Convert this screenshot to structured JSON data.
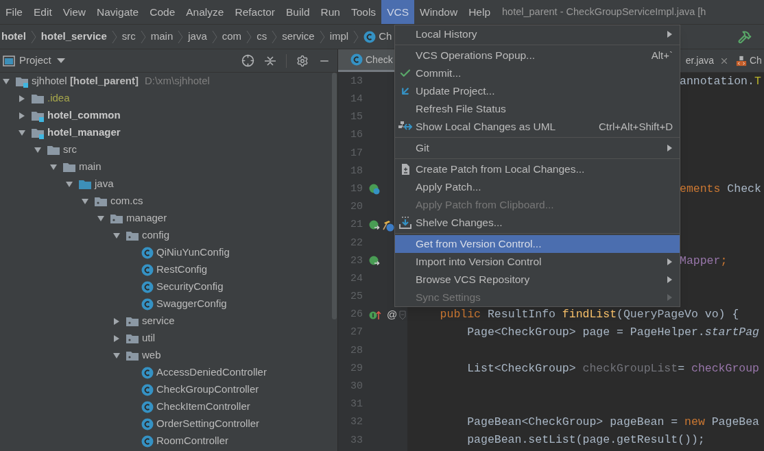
{
  "menu_bar": [
    {
      "label": "File",
      "selected": false
    },
    {
      "label": "Edit",
      "selected": false
    },
    {
      "label": "View",
      "selected": false
    },
    {
      "label": "Navigate",
      "selected": false
    },
    {
      "label": "Code",
      "selected": false
    },
    {
      "label": "Analyze",
      "selected": false
    },
    {
      "label": "Refactor",
      "selected": false
    },
    {
      "label": "Build",
      "selected": false
    },
    {
      "label": "Run",
      "selected": false
    },
    {
      "label": "Tools",
      "selected": false
    },
    {
      "label": "VCS",
      "selected": true
    },
    {
      "label": "Window",
      "selected": false
    },
    {
      "label": "Help",
      "selected": false
    }
  ],
  "window": {
    "title": "hotel_parent - CheckGroupServiceImpl.java [h"
  },
  "breadcrumb": [
    {
      "label": "hotel",
      "kind": "module"
    },
    {
      "label": "hotel_service",
      "kind": "module"
    },
    {
      "label": "src",
      "kind": "folder"
    },
    {
      "label": "main",
      "kind": "folder"
    },
    {
      "label": "java",
      "kind": "folder"
    },
    {
      "label": "com",
      "kind": "folder"
    },
    {
      "label": "cs",
      "kind": "folder"
    },
    {
      "label": "service",
      "kind": "folder"
    },
    {
      "label": "impl",
      "kind": "folder"
    },
    {
      "label": "Ch",
      "kind": "class"
    }
  ],
  "project_panel": {
    "title": "Project",
    "tree": [
      {
        "label": "sjhhotel **[hotel_parent]**",
        "path": "D:\\xm\\sjhhotel",
        "kind": "module",
        "expanded": true,
        "children": [
          {
            "label": ".idea",
            "kind": "excluded",
            "expanded": false
          },
          {
            "label": "hotel_common",
            "kind": "module",
            "expanded": false
          },
          {
            "label": "hotel_manager",
            "kind": "module",
            "expanded": true,
            "children": [
              {
                "label": "src",
                "kind": "folder",
                "expanded": true,
                "children": [
                  {
                    "label": "main",
                    "kind": "folder",
                    "expanded": true,
                    "children": [
                      {
                        "label": "java",
                        "kind": "source",
                        "expanded": true,
                        "children": [
                          {
                            "label": "com.cs",
                            "kind": "package",
                            "expanded": true,
                            "children": [
                              {
                                "label": "manager",
                                "kind": "package",
                                "expanded": true,
                                "children": [
                                  {
                                    "label": "config",
                                    "kind": "package",
                                    "expanded": true,
                                    "children": [
                                      {
                                        "label": "QiNiuYunConfig",
                                        "kind": "class"
                                      },
                                      {
                                        "label": "RestConfig",
                                        "kind": "class"
                                      },
                                      {
                                        "label": "SecurityConfig",
                                        "kind": "class"
                                      },
                                      {
                                        "label": "SwaggerConfig",
                                        "kind": "class"
                                      }
                                    ]
                                  },
                                  {
                                    "label": "service",
                                    "kind": "package",
                                    "expanded": false
                                  },
                                  {
                                    "label": "util",
                                    "kind": "package",
                                    "expanded": false
                                  },
                                  {
                                    "label": "web",
                                    "kind": "package",
                                    "expanded": true,
                                    "children": [
                                      {
                                        "label": "AccessDeniedController",
                                        "kind": "class"
                                      },
                                      {
                                        "label": "CheckGroupController",
                                        "kind": "class"
                                      },
                                      {
                                        "label": "CheckItemController",
                                        "kind": "class"
                                      },
                                      {
                                        "label": "OrderSettingController",
                                        "kind": "class"
                                      },
                                      {
                                        "label": "RoomController",
                                        "kind": "class"
                                      }
                                    ]
                                  }
                                ]
                              }
                            ]
                          }
                        ]
                      }
                    ]
                  }
                ]
              }
            ]
          }
        ]
      }
    ]
  },
  "editor_tabs": [
    {
      "label": "Check",
      "kind": "class",
      "selected": true,
      "closable": false
    },
    {
      "label": "er.java",
      "kind": "none",
      "selected": false,
      "closable": true
    },
    {
      "label": "Ch",
      "kind": "html",
      "selected": false,
      "closable": false
    }
  ],
  "code": [
    {
      "number": "13",
      "clipped": true,
      "tokens": [
        {
          "text": "annotation.",
          "kind": "plain"
        },
        {
          "text": "T",
          "kind": "annotation"
        }
      ]
    },
    {
      "number": "14"
    },
    {
      "number": "15"
    },
    {
      "number": "16"
    },
    {
      "number": "17"
    },
    {
      "number": "18"
    },
    {
      "number": "19",
      "clipped": true,
      "tokens": [
        {
          "text": "ements",
          "kind": "keyword"
        },
        {
          "text": " Check",
          "kind": "plain"
        }
      ]
    },
    {
      "number": "20"
    },
    {
      "number": "21"
    },
    {
      "number": "22"
    },
    {
      "number": "23",
      "clipped": true,
      "tokens": [
        {
          "text": "Mapper",
          "kind": "field"
        },
        {
          "text": ";",
          "kind": "keyword"
        }
      ]
    },
    {
      "number": "24"
    },
    {
      "number": "25"
    },
    {
      "number": "26",
      "gutter_text": "@",
      "fold": true,
      "clipped": false,
      "tokens": [
        {
          "text": "    public ",
          "kind": "keyword"
        },
        {
          "text": "ResultInfo ",
          "kind": "plain"
        },
        {
          "text": "findList",
          "kind": "method"
        },
        {
          "text": "(QueryPageVo vo) {",
          "kind": "plain"
        }
      ]
    },
    {
      "number": "27",
      "clipped": false,
      "tokens": [
        {
          "text": "        Page<CheckGroup> page = PageHelper.",
          "kind": "plain"
        },
        {
          "text": "startPag",
          "kind": "static"
        }
      ]
    },
    {
      "number": "28"
    },
    {
      "number": "29",
      "clipped": false,
      "tokens": [
        {
          "text": "        List<CheckGroup> ",
          "kind": "plain"
        },
        {
          "text": "checkGroupList",
          "kind": "unused"
        },
        {
          "text": "= ",
          "kind": "plain"
        },
        {
          "text": "checkGroup",
          "kind": "field"
        }
      ]
    },
    {
      "number": "30"
    },
    {
      "number": "31"
    },
    {
      "number": "32",
      "clipped": false,
      "tokens": [
        {
          "text": "        PageBean<CheckGroup> pageBean = ",
          "kind": "plain"
        },
        {
          "text": "new ",
          "kind": "keyword"
        },
        {
          "text": "PageBea",
          "kind": "plain"
        }
      ]
    },
    {
      "number": "33",
      "clipped": false,
      "tokens": [
        {
          "text": "        pageBean.setList(page.getResult());",
          "kind": "plain"
        }
      ]
    }
  ],
  "vcs_menu": [
    {
      "kind": "item",
      "label": "Local History",
      "submenu": true,
      "disabled": false,
      "selected": false
    },
    {
      "kind": "separator"
    },
    {
      "kind": "item",
      "label": "VCS Operations Popup...",
      "shortcut": "Alt+`",
      "submenu": false,
      "disabled": false,
      "selected": false
    },
    {
      "kind": "item",
      "label": "Commit...",
      "submenu": false,
      "disabled": false,
      "selected": false
    },
    {
      "kind": "item",
      "label": "Update Project...",
      "submenu": false,
      "disabled": false,
      "selected": false
    },
    {
      "kind": "item",
      "label": "Refresh File Status",
      "submenu": false,
      "disabled": false,
      "selected": false
    },
    {
      "kind": "item",
      "label": "Show Local Changes as UML",
      "shortcut": "Ctrl+Alt+Shift+D",
      "submenu": false,
      "disabled": false,
      "selected": false
    },
    {
      "kind": "separator"
    },
    {
      "kind": "item",
      "label": "Git",
      "submenu": true,
      "disabled": false,
      "selected": false
    },
    {
      "kind": "separator"
    },
    {
      "kind": "item",
      "label": "Create Patch from Local Changes...",
      "submenu": false,
      "disabled": false,
      "selected": false
    },
    {
      "kind": "item",
      "label": "Apply Patch...",
      "submenu": false,
      "disabled": false,
      "selected": false
    },
    {
      "kind": "item",
      "label": "Apply Patch from Clipboard...",
      "submenu": false,
      "disabled": true,
      "selected": false
    },
    {
      "kind": "item",
      "label": "Shelve Changes...",
      "submenu": false,
      "disabled": false,
      "selected": false
    },
    {
      "kind": "separator"
    },
    {
      "kind": "item",
      "label": "Get from Version Control...",
      "submenu": false,
      "disabled": false,
      "selected": true
    },
    {
      "kind": "item",
      "label": "Import into Version Control",
      "submenu": true,
      "disabled": false,
      "selected": false
    },
    {
      "kind": "item",
      "label": "Browse VCS Repository",
      "submenu": true,
      "disabled": false,
      "selected": false
    },
    {
      "kind": "item",
      "label": "Sync Settings",
      "submenu": true,
      "disabled": true,
      "selected": false
    }
  ]
}
